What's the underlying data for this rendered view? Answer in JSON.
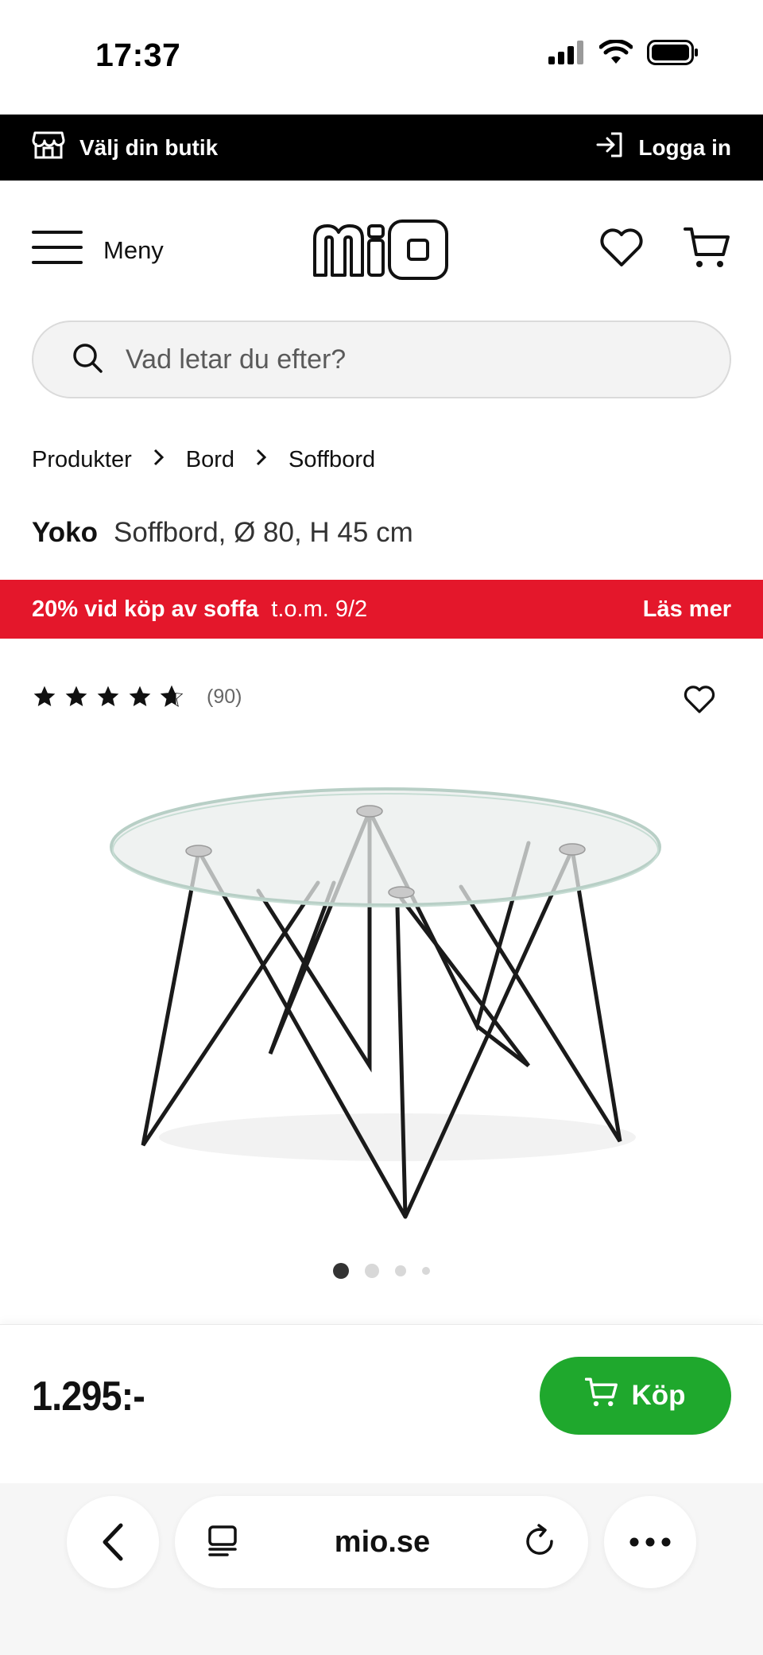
{
  "status_bar": {
    "time": "17:37",
    "icons": [
      "cellular-signal-icon",
      "wifi-icon",
      "battery-icon"
    ]
  },
  "store_bar": {
    "store_label": "Välj din butik",
    "store_icon": "store-icon",
    "login_label": "Logga in",
    "login_icon": "login-icon"
  },
  "header": {
    "menu_label": "Meny",
    "logo_text": "mio",
    "wishlist_icon": "heart-icon",
    "cart_icon": "cart-icon"
  },
  "search": {
    "placeholder": "Vad letar du efter?"
  },
  "breadcrumb": {
    "items": [
      "Produkter",
      "Bord",
      "Soffbord"
    ]
  },
  "product": {
    "brand": "Yoko",
    "description": "Soffbord, Ø 80, H 45 cm",
    "rating_value": 4.5,
    "rating_max": 5,
    "review_count": "(90)",
    "image_count": 4,
    "active_image": 1,
    "price": "1.295:-"
  },
  "promo": {
    "highlight": "20% vid köp av soffa",
    "period": "t.o.m. 9/2",
    "link_label": "Läs mer",
    "color": "#e4172b"
  },
  "buy": {
    "label": "Köp",
    "color": "#1fa82d"
  },
  "browser": {
    "url": "mio.se"
  }
}
